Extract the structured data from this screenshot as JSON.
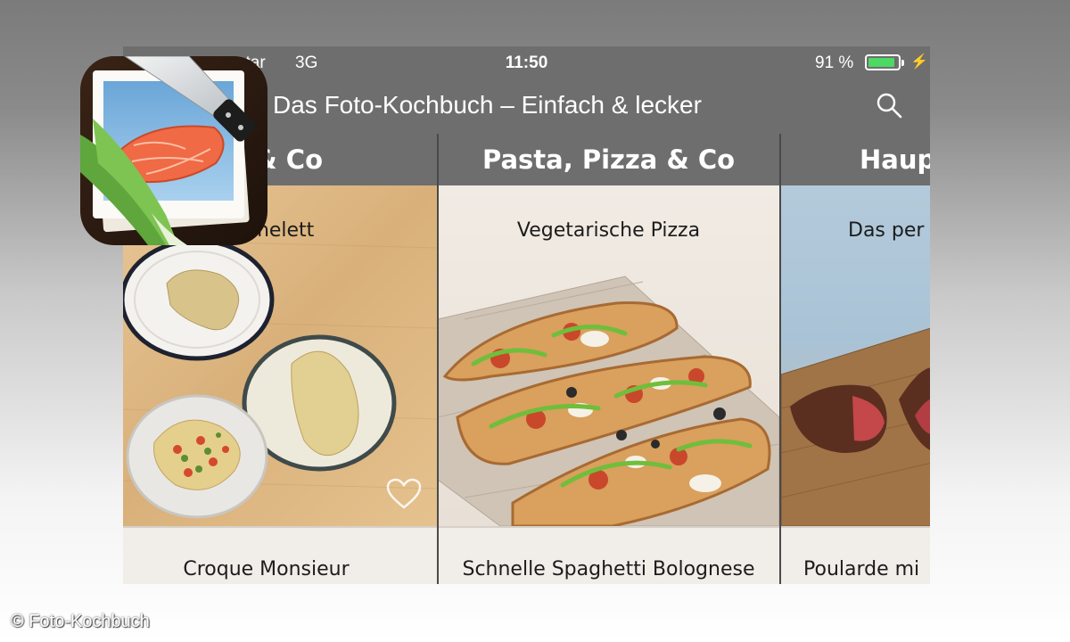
{
  "status_bar": {
    "carrier": "star",
    "network": "3G",
    "time": "11:50",
    "battery_pct": "91 %",
    "battery_level": 0.91
  },
  "nav": {
    "title": "Das Foto-Kochbuch – Einfach & lecker",
    "search_icon": "search-icon"
  },
  "columns": [
    {
      "category": "en & Co",
      "recipe": "s Omelett",
      "next_recipe": "Croque Monsieur"
    },
    {
      "category": "Pasta, Pizza & Co",
      "recipe": "Vegetarische Pizza",
      "next_recipe": "Schnelle Spaghetti Bolognese"
    },
    {
      "category": "Haup",
      "recipe": "Das per",
      "next_recipe": "Poularde mi"
    }
  ],
  "favorite_icon": "heart-icon",
  "app_icon": "foto-kochbuch-app-icon",
  "copyright": "© Foto-Kochbuch",
  "colors": {
    "bar": "#6e6e6e",
    "battery": "#4cd964",
    "separator": "#4a4a4a"
  }
}
